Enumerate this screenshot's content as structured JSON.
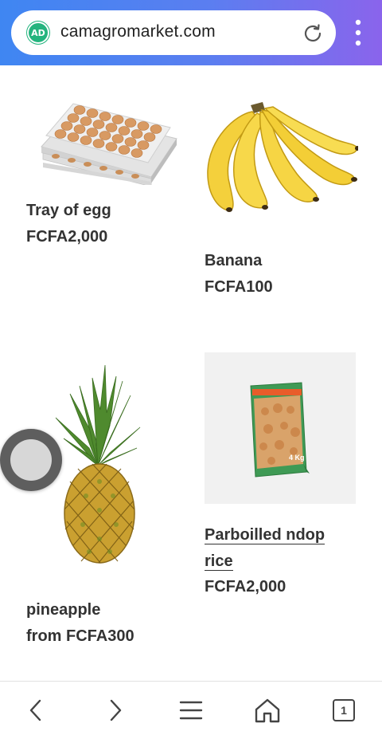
{
  "browser": {
    "url": "camagromarket.com",
    "ad_badge": "AD",
    "tab_count": "1",
    "theme_colors": [
      "#3f86f2",
      "#8a64ec"
    ]
  },
  "products": [
    {
      "name": "Tray of egg",
      "price": "FCFA2,000",
      "icon": "egg-tray-image"
    },
    {
      "name": "Banana",
      "price": "FCFA100",
      "icon": "banana-image"
    },
    {
      "name": "pineapple",
      "price": "from FCFA300",
      "icon": "pineapple-image"
    },
    {
      "name_line1": "Parboilled ndop",
      "name_line2": "rice",
      "price": "FCFA2,000",
      "icon": "rice-bag-image",
      "bag_label": "4 Kg"
    }
  ],
  "nav": {
    "icons": [
      "back-icon",
      "forward-icon",
      "menu-icon",
      "home-icon",
      "tabs-icon"
    ]
  }
}
